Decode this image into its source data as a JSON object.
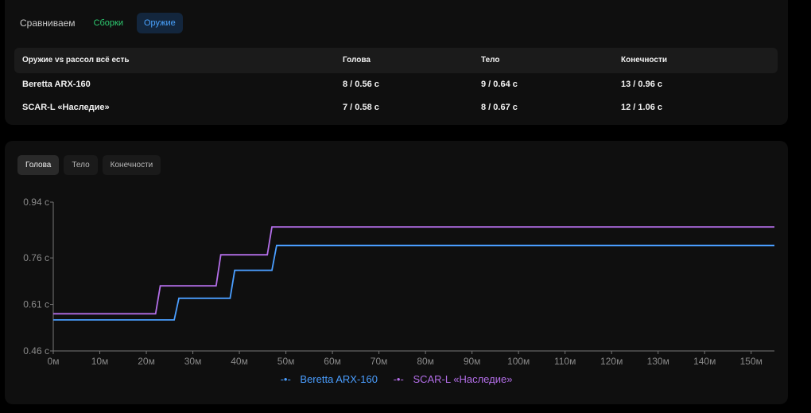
{
  "header": {
    "title": "Сравниваем",
    "tabs": [
      {
        "label": "Сборки",
        "active": false
      },
      {
        "label": "Оружие",
        "active": true
      }
    ]
  },
  "table": {
    "columns": [
      "Оружие vs рассол всё есть",
      "Голова",
      "Тело",
      "Конечности"
    ],
    "rows": [
      [
        "Beretta ARX-160",
        "8 / 0.56 с",
        "9 / 0.64 с",
        "13 / 0.96 с"
      ],
      [
        "SCAR-L «Наследие»",
        "7 / 0.58 с",
        "8 / 0.67 с",
        "12 / 1.06 с"
      ]
    ]
  },
  "chart_tabs": [
    "Голова",
    "Тело",
    "Конечности"
  ],
  "colors": {
    "beretta": "#4a9eff",
    "scar": "#b36ee8",
    "accent": "#4aa3ff",
    "green": "#2ecc71"
  },
  "chart_data": {
    "type": "line",
    "step": true,
    "x_unit": "м",
    "y_unit": "с",
    "xlim": [
      0,
      155
    ],
    "ylim": [
      0.46,
      0.94
    ],
    "x_ticks": [
      "0м",
      "10м",
      "20м",
      "30м",
      "40м",
      "50м",
      "60м",
      "70м",
      "80м",
      "90м",
      "100м",
      "110м",
      "120м",
      "130м",
      "140м",
      "150м"
    ],
    "y_ticks": [
      "0.46 с",
      "0.61 с",
      "0.76 с",
      "0.94 с"
    ],
    "y_tick_values": [
      0.46,
      0.61,
      0.76,
      0.94
    ],
    "grid": false,
    "legend_position": "bottom-center",
    "series": [
      {
        "name": "Beretta ARX-160",
        "color": "#4a9eff",
        "points": [
          [
            0,
            0.56
          ],
          [
            26,
            0.56
          ],
          [
            27,
            0.63
          ],
          [
            38,
            0.63
          ],
          [
            39,
            0.72
          ],
          [
            47,
            0.72
          ],
          [
            48,
            0.8
          ],
          [
            155,
            0.8
          ]
        ]
      },
      {
        "name": "SCAR-L «Наследие»",
        "color": "#b36ee8",
        "points": [
          [
            0,
            0.58
          ],
          [
            22,
            0.58
          ],
          [
            23,
            0.67
          ],
          [
            35,
            0.67
          ],
          [
            36,
            0.77
          ],
          [
            46,
            0.77
          ],
          [
            47,
            0.86
          ],
          [
            155,
            0.86
          ]
        ]
      }
    ]
  }
}
